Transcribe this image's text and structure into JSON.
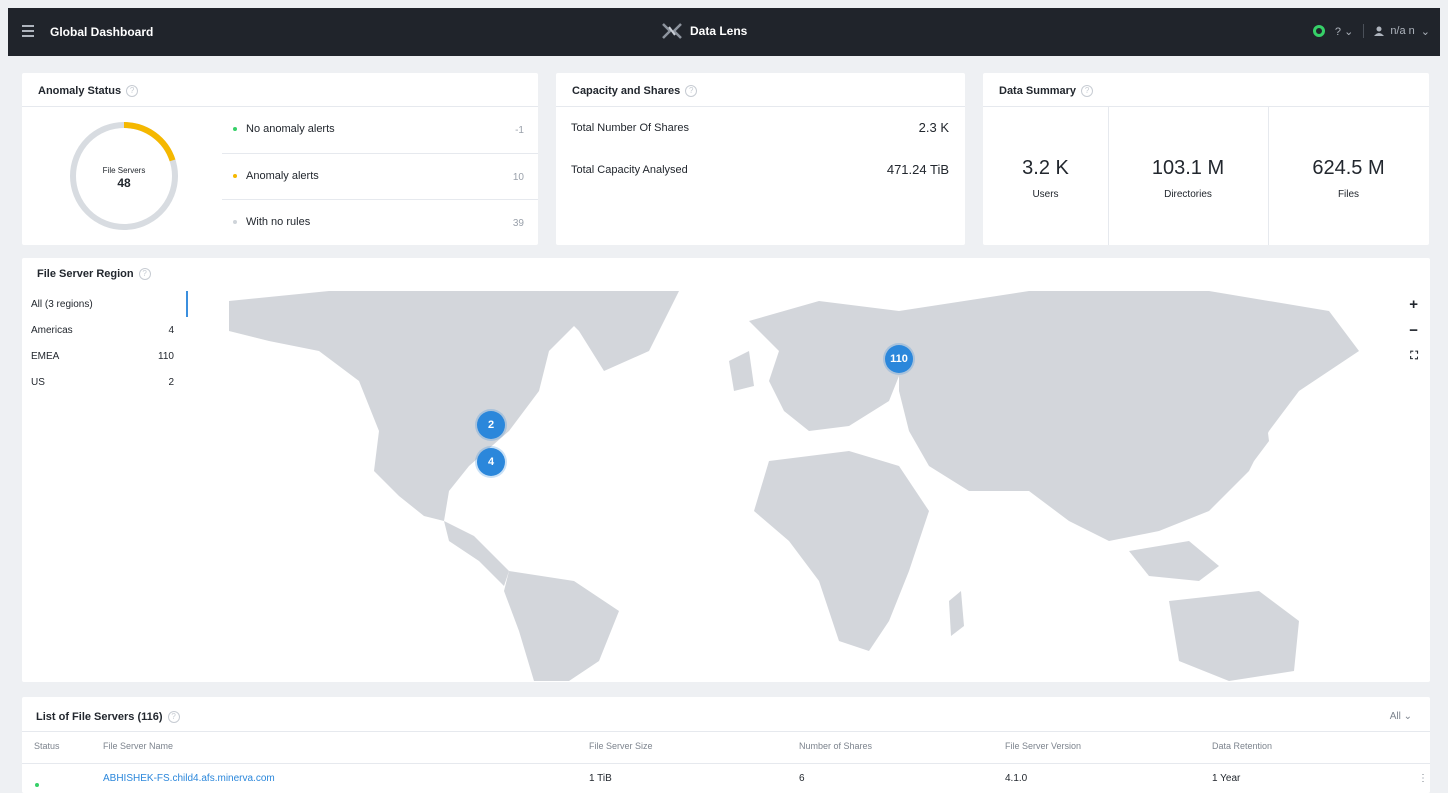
{
  "header": {
    "title": "Global Dashboard",
    "brand": "Data Lens",
    "help_label": "?",
    "user_name": "n/a n"
  },
  "anomaly_status": {
    "title": "Anomaly Status",
    "donut_label": "File Servers",
    "donut_value": "48",
    "donut_fraction": 0.2,
    "rows": [
      {
        "label": "No anomaly alerts",
        "count": "-1",
        "color": "#36d068"
      },
      {
        "label": "Anomaly alerts",
        "count": "10",
        "color": "#f5b800"
      },
      {
        "label": "With no rules",
        "count": "39",
        "color": "#cfd4da"
      }
    ]
  },
  "capacity": {
    "title": "Capacity and Shares",
    "rows": [
      {
        "label": "Total Number Of Shares",
        "value": "2.3 K"
      },
      {
        "label": "Total Capacity Analysed",
        "value": "471.24 TiB"
      }
    ]
  },
  "data_summary": {
    "title": "Data Summary",
    "metrics": [
      {
        "value": "3.2 K",
        "label": "Users"
      },
      {
        "value": "103.1 M",
        "label": "Directories"
      },
      {
        "value": "624.5 M",
        "label": "Files"
      }
    ]
  },
  "region": {
    "title": "File Server Region",
    "items": [
      {
        "name": "All (3 regions)",
        "count": ""
      },
      {
        "name": "Americas",
        "count": "4"
      },
      {
        "name": "EMEA",
        "count": "110"
      },
      {
        "name": "US",
        "count": "2"
      }
    ],
    "clusters": [
      "110",
      "2",
      "4"
    ],
    "controls": {
      "zoom_in": "+",
      "zoom_out": "−"
    },
    "colors": {
      "land": "#d3d6db"
    }
  },
  "file_servers": {
    "title": "List of File Servers (116)",
    "filter": "All",
    "columns": [
      "Status",
      "File Server Name",
      "File Server Size",
      "Number of Shares",
      "File Server Version",
      "Data Retention"
    ],
    "rows": [
      {
        "name": "ABHISHEK-FS.child4.afs.minerva.com",
        "size": "1 TiB",
        "shares": "6",
        "version": "4.1.0",
        "retention": "1 Year",
        "status_color": "#36d068"
      }
    ]
  },
  "colors": {
    "accent": "#2b87db",
    "topbar": "#20242b",
    "green": "#36d068",
    "amber": "#f5b800"
  }
}
